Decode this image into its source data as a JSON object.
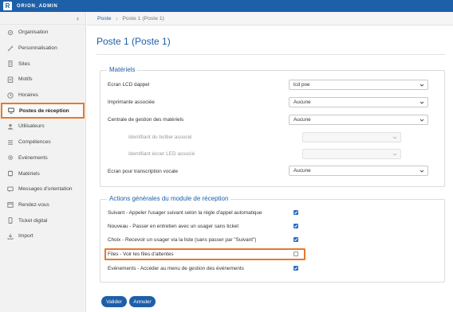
{
  "app": {
    "brand": "ORION_ADMIN",
    "logo_letter": "R",
    "accent": "#1d5fa8",
    "highlight": "#e8782a"
  },
  "sidebar": {
    "collapse_icon": "chevron-left-icon",
    "items": [
      {
        "label": "Organisation",
        "icon": "building-icon"
      },
      {
        "label": "Personnalisation",
        "icon": "brush-icon"
      },
      {
        "label": "Sites",
        "icon": "site-icon"
      },
      {
        "label": "Motifs",
        "icon": "clipboard-icon"
      },
      {
        "label": "Horaires",
        "icon": "clock-icon"
      },
      {
        "label": "Postes de réception",
        "icon": "monitor-icon",
        "active": true
      },
      {
        "label": "Utilisateurs",
        "icon": "user-icon"
      },
      {
        "label": "Compétences",
        "icon": "list-icon"
      },
      {
        "label": "Evénements",
        "icon": "gear-icon"
      },
      {
        "label": "Matériels",
        "icon": "hardware-icon"
      },
      {
        "label": "Messages d'orientation",
        "icon": "message-icon"
      },
      {
        "label": "Rendez-vous",
        "icon": "calendar-icon"
      },
      {
        "label": "Ticket digital",
        "icon": "phone-icon"
      },
      {
        "label": "Import",
        "icon": "download-icon"
      }
    ]
  },
  "breadcrumb": {
    "root": "Poste",
    "current": "Poste 1 (Poste 1)"
  },
  "page": {
    "title": "Poste 1 (Poste 1)"
  },
  "materiels": {
    "legend": "Matériels",
    "lcd": {
      "label": "Ecran LCD dappel",
      "value": "lcd poe"
    },
    "printer": {
      "label": "Imprimante associée",
      "value": "Aucune"
    },
    "central": {
      "label": "Centrale de gestion des matériels",
      "value": "Aucune"
    },
    "boitier": {
      "label": "Identifiant du boîtier associé",
      "value": ""
    },
    "led": {
      "label": "Identifiant écran LED associé",
      "value": ""
    },
    "voice": {
      "label": "Ecran pour transcription vocale",
      "value": "Aucune"
    }
  },
  "actions": {
    "legend": "Actions générales du module de réception",
    "items": [
      {
        "label": "Suivant - Appeler l'usager suivant selon la règle d'appel automatique",
        "checked": true
      },
      {
        "label": "Nouveau - Passer en entretien avec un usager sans ticket",
        "checked": true
      },
      {
        "label": "Choix - Recevoir un usager via la liste (sans passer par \"Suivant\")",
        "checked": true
      },
      {
        "label": "Files - Voir les files d'attentes",
        "checked": false
      },
      {
        "label": "Evénements - Accéder au menu de gestion des événements",
        "checked": true
      }
    ]
  },
  "buttons": {
    "validate": "Valider",
    "cancel": "Annuler"
  }
}
